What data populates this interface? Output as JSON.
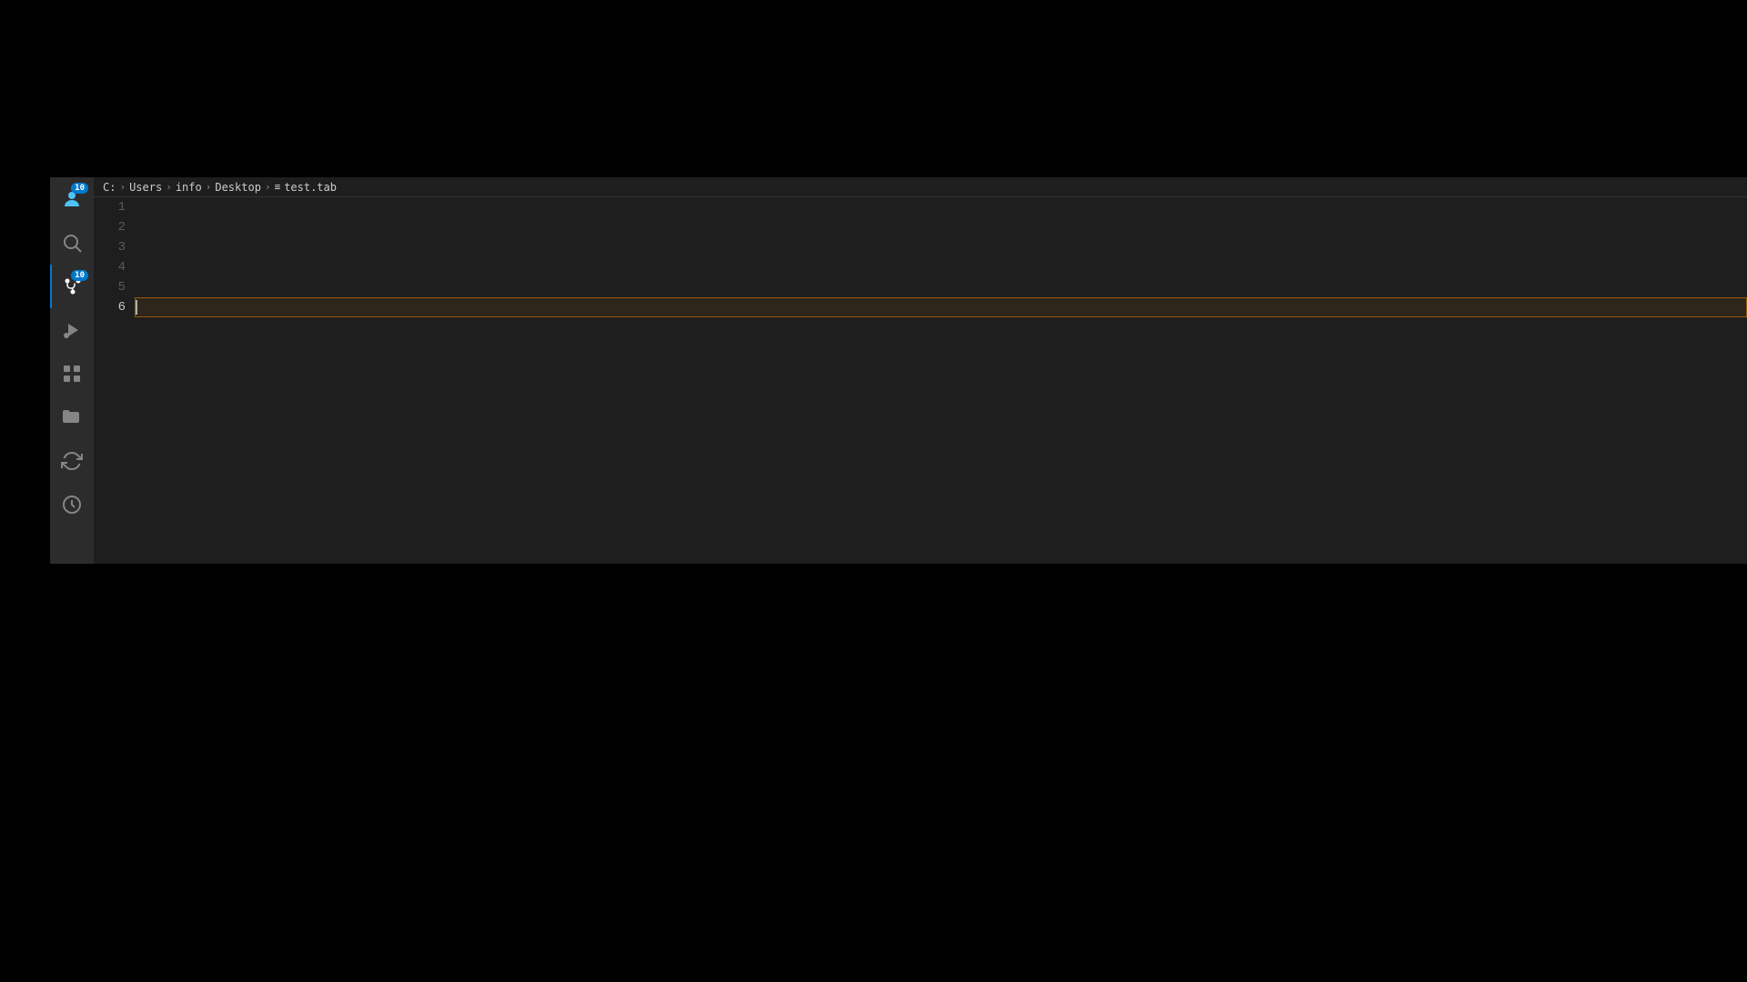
{
  "breadcrumb": {
    "drive": "C:",
    "path_items": [
      {
        "label": "Users"
      },
      {
        "label": "info"
      },
      {
        "label": "Desktop"
      }
    ],
    "file": "test.tab"
  },
  "editor": {
    "line_numbers": [
      "1",
      "2",
      "3",
      "4",
      "5",
      "6"
    ],
    "active_line": 6
  },
  "activity_bar": {
    "icons": [
      {
        "name": "source-control-icon",
        "label": "Source Control",
        "active": false,
        "badge": "10"
      },
      {
        "name": "search-icon",
        "label": "Search",
        "active": false
      },
      {
        "name": "extensions-icon",
        "label": "Extensions",
        "active": true,
        "badge": "10"
      },
      {
        "name": "run-icon",
        "label": "Run",
        "active": false
      },
      {
        "name": "extensions-panel-icon",
        "label": "Extensions Panel",
        "active": false
      },
      {
        "name": "explorer-icon",
        "label": "Explorer",
        "active": false
      },
      {
        "name": "source-icon",
        "label": "Source Control",
        "active": false
      },
      {
        "name": "timer-icon",
        "label": "Timeline",
        "active": false
      }
    ]
  }
}
